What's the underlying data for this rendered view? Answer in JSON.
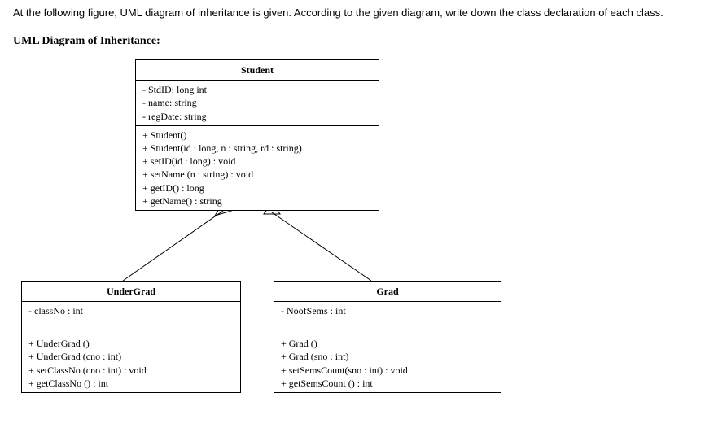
{
  "instruction": "At the following figure, UML diagram of inheritance is given. According to the given diagram, write down the class declaration of each class.",
  "title": "UML Diagram of Inheritance:",
  "student": {
    "name": "Student",
    "attrs": [
      "- StdID: long int",
      "- name: string",
      "- regDate: string"
    ],
    "ops": [
      "+ Student()",
      "+ Student(id : long, n : string, rd : string)",
      "+ setID(id : long) : void",
      "+ setName (n : string) : void",
      "+ getID() : long",
      "+ getName() : string"
    ]
  },
  "undergrad": {
    "name": "UnderGrad",
    "attrs": [
      "- classNo : int"
    ],
    "ops": [
      "+ UnderGrad ()",
      "+ UnderGrad (cno : int)",
      "+ setClassNo (cno : int) : void",
      "+ getClassNo () : int"
    ]
  },
  "grad": {
    "name": "Grad",
    "attrs": [
      "- NoofSems : int"
    ],
    "ops": [
      "+ Grad ()",
      "+ Grad (sno : int)",
      "+ setSemsCount(sno : int) : void",
      "+ getSemsCount () : int"
    ]
  },
  "chart_data": {
    "type": "uml",
    "classes": [
      {
        "name": "Student",
        "attributes": [
          {
            "visibility": "-",
            "name": "StdID",
            "type": "long int"
          },
          {
            "visibility": "-",
            "name": "name",
            "type": "string"
          },
          {
            "visibility": "-",
            "name": "regDate",
            "type": "string"
          }
        ],
        "operations": [
          {
            "visibility": "+",
            "signature": "Student()"
          },
          {
            "visibility": "+",
            "signature": "Student(id : long, n : string, rd : string)"
          },
          {
            "visibility": "+",
            "signature": "setID(id : long) : void"
          },
          {
            "visibility": "+",
            "signature": "setName (n : string) : void"
          },
          {
            "visibility": "+",
            "signature": "getID() : long"
          },
          {
            "visibility": "+",
            "signature": "getName() : string"
          }
        ]
      },
      {
        "name": "UnderGrad",
        "extends": "Student",
        "attributes": [
          {
            "visibility": "-",
            "name": "classNo",
            "type": "int"
          }
        ],
        "operations": [
          {
            "visibility": "+",
            "signature": "UnderGrad ()"
          },
          {
            "visibility": "+",
            "signature": "UnderGrad (cno : int)"
          },
          {
            "visibility": "+",
            "signature": "setClassNo (cno : int) : void"
          },
          {
            "visibility": "+",
            "signature": "getClassNo () : int"
          }
        ]
      },
      {
        "name": "Grad",
        "extends": "Student",
        "attributes": [
          {
            "visibility": "-",
            "name": "NoofSems",
            "type": "int"
          }
        ],
        "operations": [
          {
            "visibility": "+",
            "signature": "Grad ()"
          },
          {
            "visibility": "+",
            "signature": "Grad (sno : int)"
          },
          {
            "visibility": "+",
            "signature": "setSemsCount(sno : int) : void"
          },
          {
            "visibility": "+",
            "signature": "getSemsCount () : int"
          }
        ]
      }
    ],
    "relations": [
      {
        "type": "generalization",
        "from": "UnderGrad",
        "to": "Student"
      },
      {
        "type": "generalization",
        "from": "Grad",
        "to": "Student"
      }
    ]
  }
}
